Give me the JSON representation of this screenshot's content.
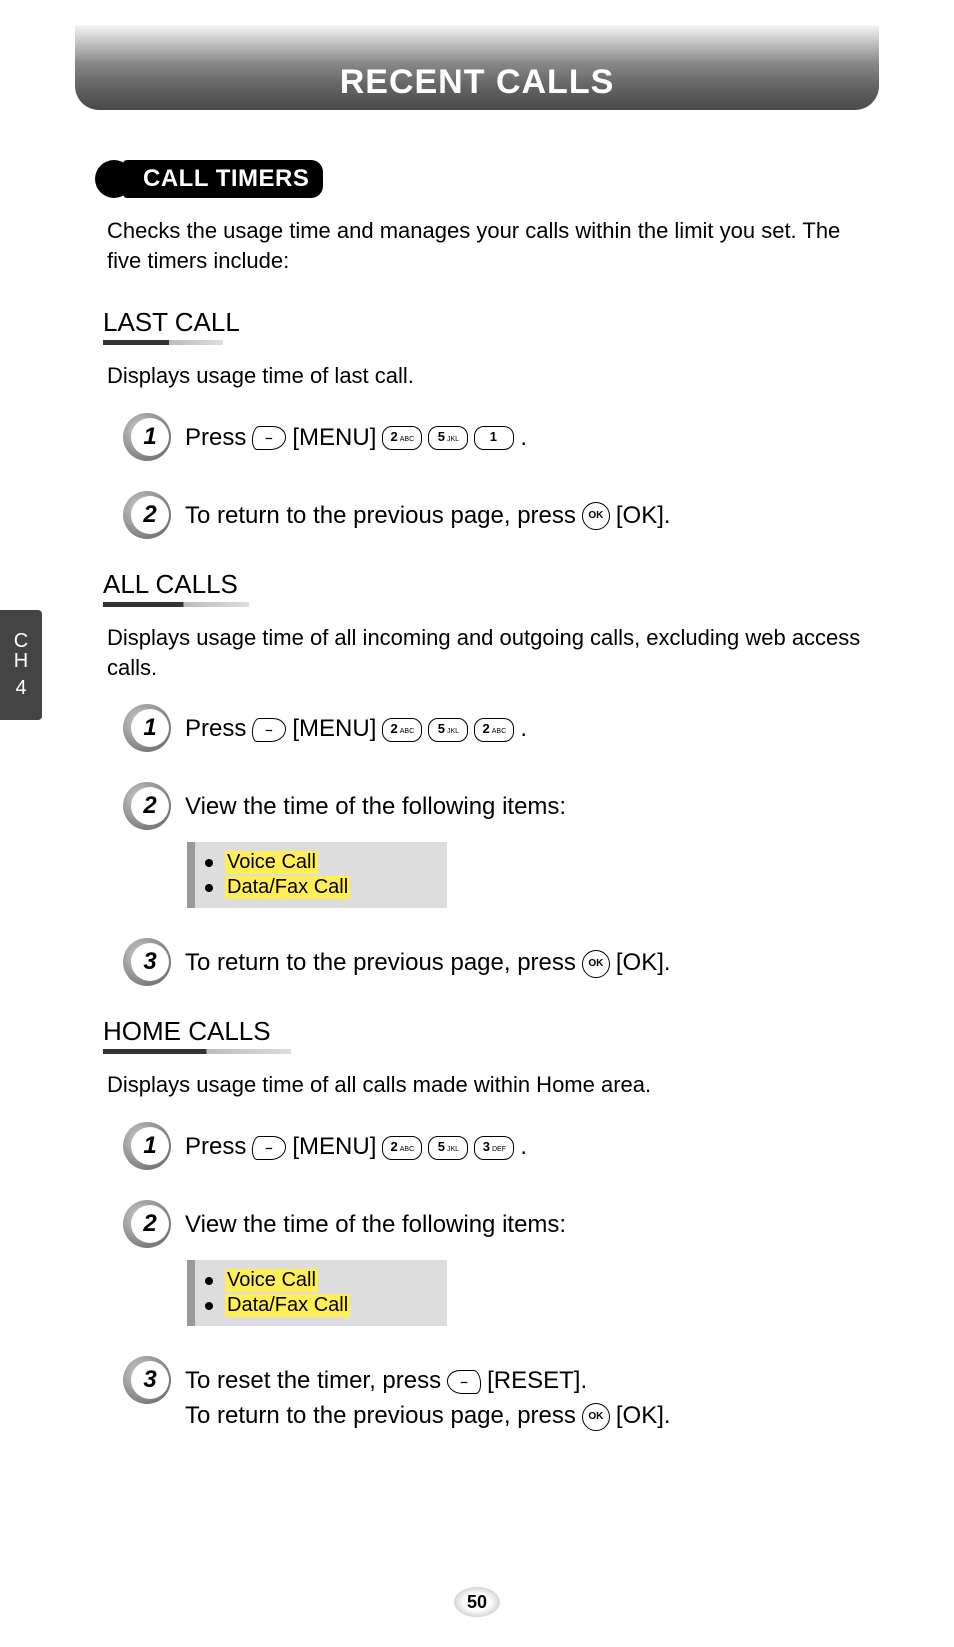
{
  "banner": {
    "title": "RECENT CALLS"
  },
  "section": {
    "title": "CALL TIMERS"
  },
  "intro": "Checks the usage time and manages your calls within the limit you set. The five timers include:",
  "chapter": {
    "label": "C\nH",
    "num": "4"
  },
  "page_number": "50",
  "keys": {
    "softkey_dash": "–",
    "ok": "OK",
    "k1": {
      "n": "1",
      "s": ""
    },
    "k2": {
      "n": "2",
      "s": "ABC"
    },
    "k3": {
      "n": "3",
      "s": "DEF"
    },
    "k5": {
      "n": "5",
      "s": "JKL"
    }
  },
  "labels": {
    "press": "Press",
    "menu": "[MENU]",
    "ok": "[OK].",
    "reset": "[RESET].",
    "return_prev": "To return to the previous page, press",
    "view_items": "View the time of the following items:",
    "reset_timer": "To reset the timer, press",
    "period": "."
  },
  "subsections": [
    {
      "heading": "LAST CALL",
      "desc": "Displays usage time of last call.",
      "steps": [
        {
          "n": "1",
          "type": "press",
          "seq": [
            "2",
            "5",
            "1"
          ]
        },
        {
          "n": "2",
          "type": "return_ok"
        }
      ]
    },
    {
      "heading": "ALL CALLS",
      "desc": "Displays usage time of all incoming and outgoing calls, excluding web access calls.",
      "steps": [
        {
          "n": "1",
          "type": "press",
          "seq": [
            "2",
            "5",
            "2"
          ]
        },
        {
          "n": "2",
          "type": "view_items",
          "items": [
            "Voice Call",
            "Data/Fax Call"
          ]
        },
        {
          "n": "3",
          "type": "return_ok"
        }
      ]
    },
    {
      "heading": "HOME CALLS",
      "desc": "Displays usage time of all calls made within Home area.",
      "steps": [
        {
          "n": "1",
          "type": "press",
          "seq": [
            "2",
            "5",
            "3"
          ]
        },
        {
          "n": "2",
          "type": "view_items",
          "items": [
            "Voice Call",
            "Data/Fax Call"
          ]
        },
        {
          "n": "3",
          "type": "reset_and_return"
        }
      ]
    }
  ]
}
